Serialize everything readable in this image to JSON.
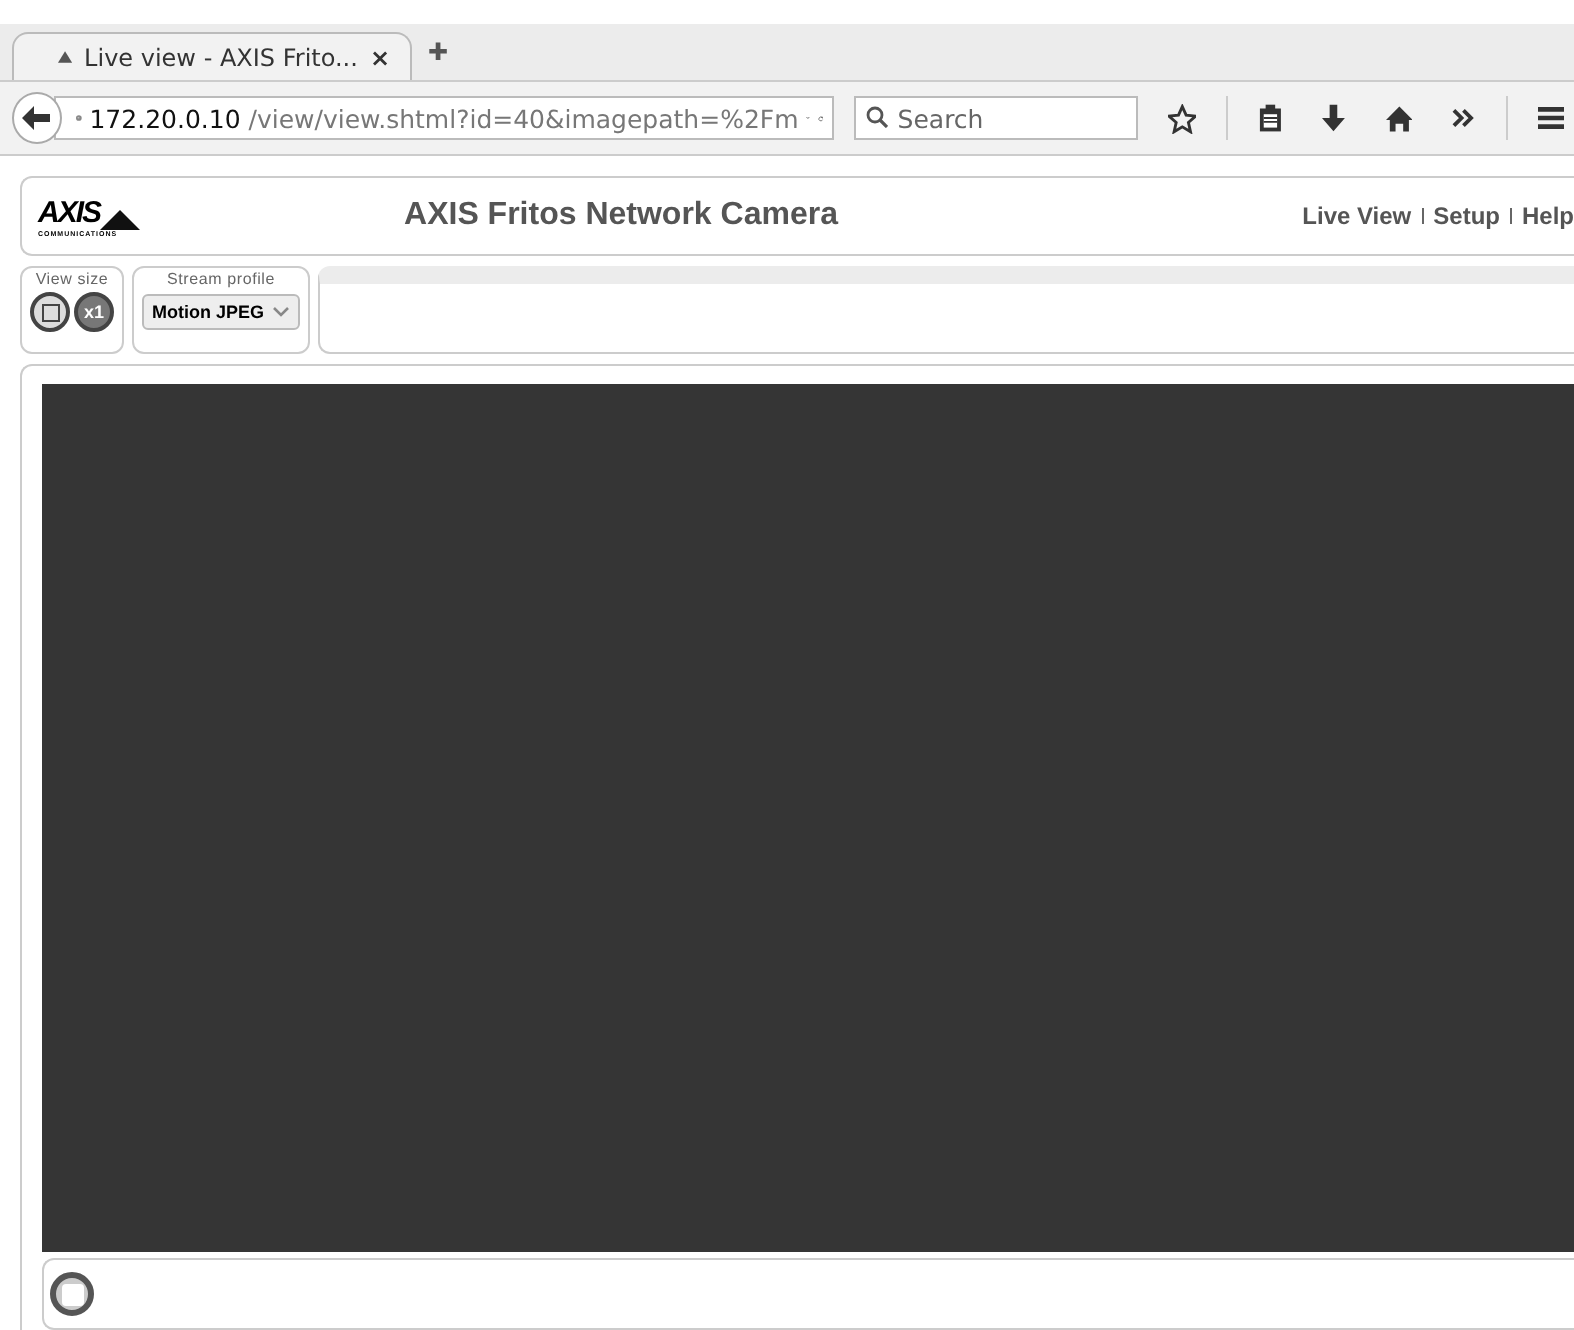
{
  "browser": {
    "tabs": [
      {
        "title": "Live view - AXIS Frito...",
        "close": "×",
        "selected": true
      }
    ],
    "new_tab": "✚",
    "url_host": "172.20.0.10",
    "url_path": "/view/view.shtml?id=40&imagepath=%2Fm",
    "search": {
      "placeholder": "Search"
    }
  },
  "header": {
    "logo": "AXIS",
    "logo_sub": "COMMUNICATIONS",
    "title": "AXIS Fritos Network Camera",
    "links": [
      "Live View",
      "Setup",
      "Help"
    ]
  },
  "controls": {
    "view_size_label": "View size",
    "zoom_label": "x1",
    "stream_label": "Stream profile",
    "stream_value": "Motion JPEG"
  }
}
